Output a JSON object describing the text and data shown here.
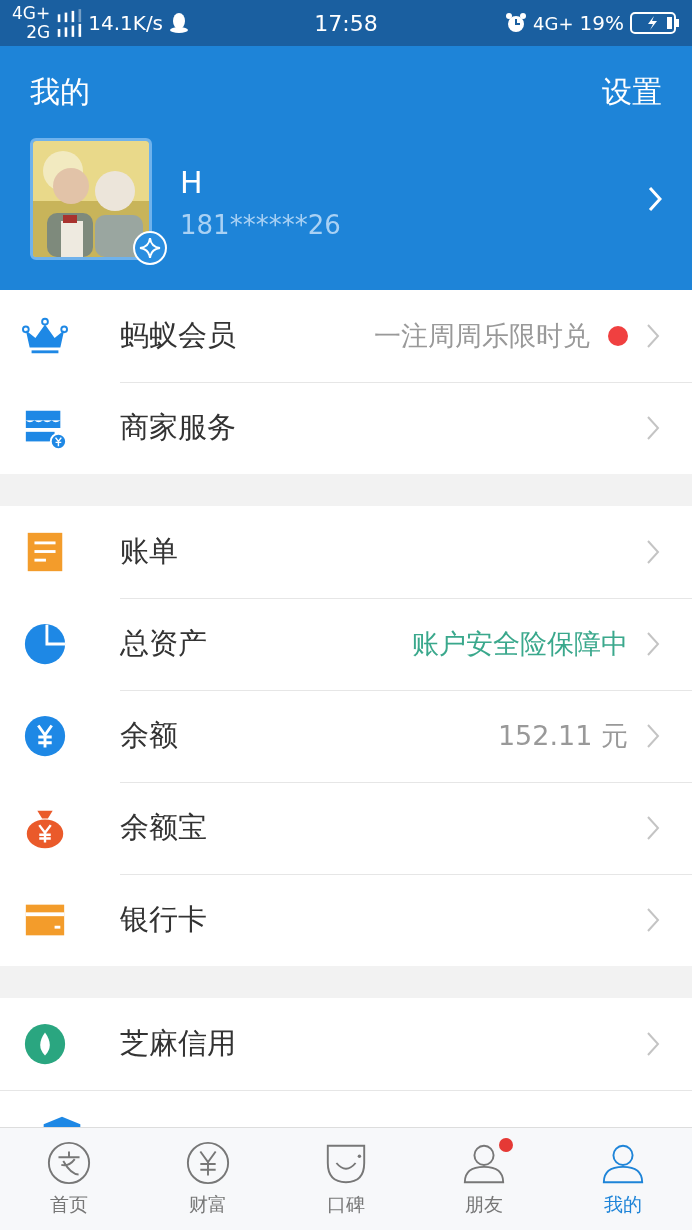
{
  "status_bar": {
    "network_top": "4G+",
    "network_bottom": "2G",
    "speed": "14.1K/s",
    "time": "17:58",
    "network_right": "4G+",
    "battery": "19%"
  },
  "header": {
    "title": "我的",
    "settings": "设置",
    "name": "H",
    "phone": "181******26"
  },
  "sections": [
    {
      "rows": [
        {
          "label": "蚂蚁会员",
          "value": "一注周周乐限时兑",
          "kind": "hint",
          "badge": true
        },
        {
          "label": "商家服务",
          "badge": false
        }
      ]
    },
    {
      "rows": [
        {
          "label": "账单",
          "badge": false
        },
        {
          "label": "总资产",
          "value": "账户安全险保障中",
          "kind": "safe",
          "badge": false
        },
        {
          "label": "余额",
          "value": "152.11 元",
          "kind": "amount",
          "badge": false
        },
        {
          "label": "余额宝",
          "badge": false
        },
        {
          "label": "银行卡",
          "badge": false
        }
      ]
    },
    {
      "rows": [
        {
          "label": "芝麻信用",
          "badge": false
        }
      ]
    }
  ],
  "tabs": [
    {
      "label": "首页",
      "selected": false
    },
    {
      "label": "财富",
      "selected": false
    },
    {
      "label": "口碑",
      "selected": false
    },
    {
      "label": "朋友",
      "selected": false,
      "badge": true
    },
    {
      "label": "我的",
      "selected": true
    }
  ]
}
